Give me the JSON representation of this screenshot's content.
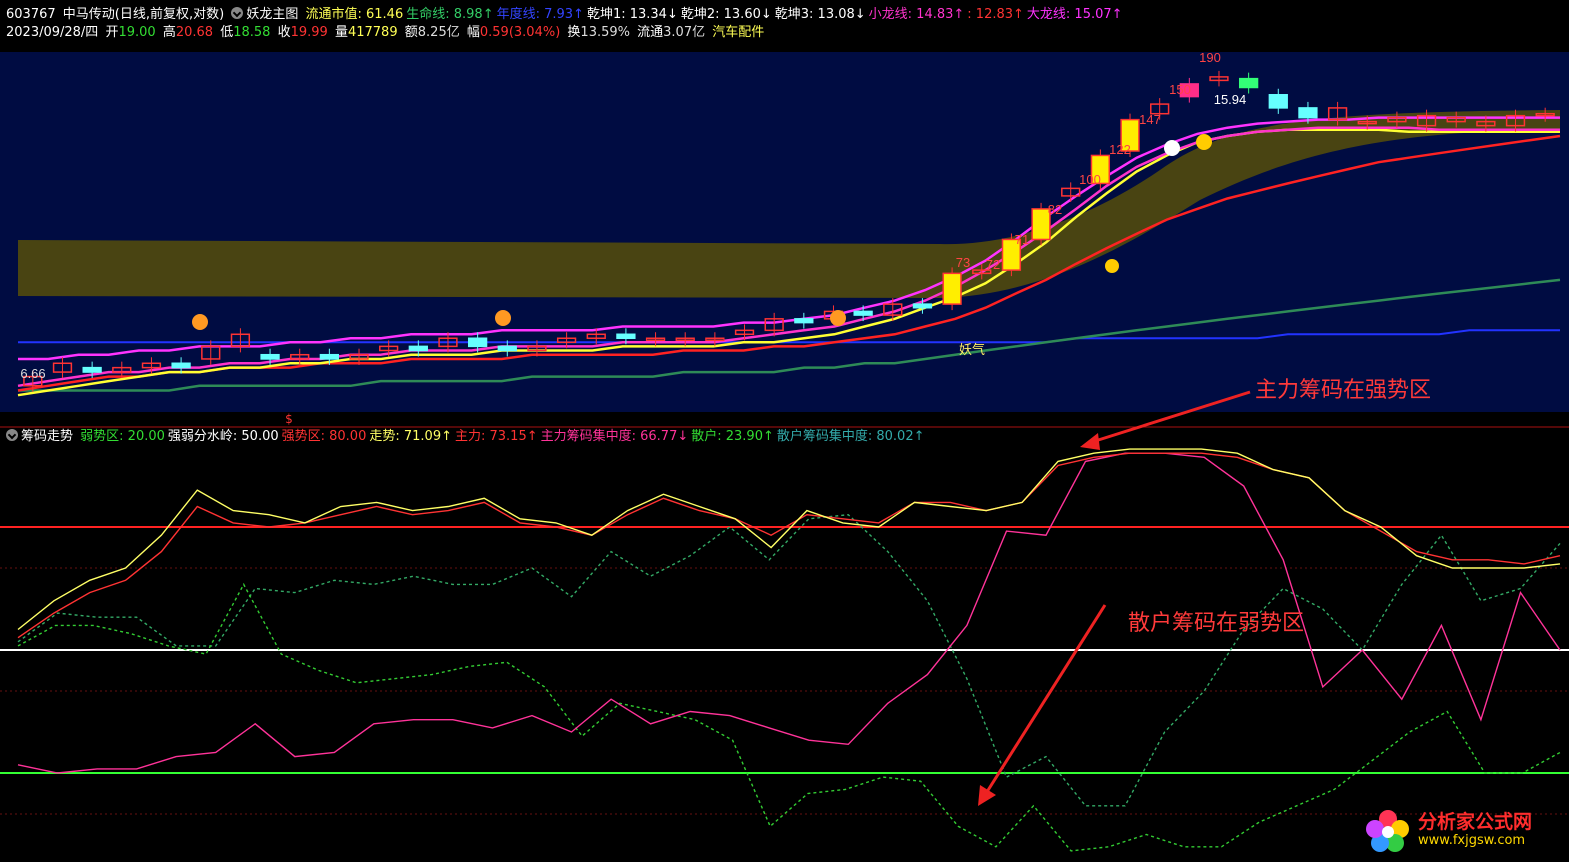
{
  "header": {
    "code": "603767",
    "name_period": "中马传动(日线,前复权,对数)",
    "indicator_name": "妖龙主图",
    "items": [
      {
        "label": "流通市值:",
        "value": "61.46",
        "color": "#ffff55",
        "arrow": ""
      },
      {
        "label": "生命线:",
        "value": "8.98",
        "color": "#33cc66",
        "arrow": "↑"
      },
      {
        "label": "年度线:",
        "value": "7.93",
        "color": "#3344ff",
        "arrow": "↑"
      },
      {
        "label": "乾坤1:",
        "value": "13.34",
        "color": "#ffffff",
        "arrow": "↓"
      },
      {
        "label": "乾坤2:",
        "value": "13.60",
        "color": "#ffffff",
        "arrow": "↓"
      },
      {
        "label": "乾坤3:",
        "value": "13.08",
        "color": "#ffffff",
        "arrow": "↓"
      },
      {
        "label": "小龙线:",
        "value": "14.83",
        "color": "#ff33cc",
        "arrow": "↑"
      },
      {
        "label": ":",
        "value": "12.83",
        "color": "#ff3333",
        "arrow": "↑"
      },
      {
        "label": "大龙线:",
        "value": "15.07",
        "color": "#ff33ff",
        "arrow": "↑"
      }
    ]
  },
  "quote": {
    "date": "2023/09/28/四",
    "open_label": "开",
    "open": "19.00",
    "high_label": "高",
    "high": "20.68",
    "low_label": "低",
    "low": "18.58",
    "close_label": "收",
    "close": "19.99",
    "vol_label": "量",
    "vol": "417789",
    "amt_label": "额",
    "amt": "8.25亿",
    "chg_label": "幅",
    "chg": "0.59(3.04%)",
    "turn_label": "换",
    "turn": "13.59%",
    "float_label": "流通",
    "float": "3.07亿",
    "sector": "汽车配件"
  },
  "indicator": {
    "name": "筹码走势",
    "items": [
      {
        "label": "弱势区:",
        "value": "20.00",
        "color": "#33dd33",
        "arrow": ""
      },
      {
        "label": "强弱分水岭:",
        "value": "50.00",
        "color": "#ffffff",
        "arrow": ""
      },
      {
        "label": "强势区:",
        "value": "80.00",
        "color": "#ff3333",
        "arrow": ""
      },
      {
        "label": "走势:",
        "value": "71.09",
        "color": "#ffff66",
        "arrow": "↑"
      },
      {
        "label": "主力:",
        "value": "73.15",
        "color": "#ff3333",
        "arrow": "↑"
      },
      {
        "label": "主力筹码集中度:",
        "value": "66.77",
        "color": "#ff3399",
        "arrow": "↓"
      },
      {
        "label": "散户:",
        "value": "23.90",
        "color": "#33dd33",
        "arrow": "↑"
      },
      {
        "label": "散户筹码集中度:",
        "value": "80.02",
        "color": "#33aaaa",
        "arrow": "↑"
      }
    ]
  },
  "annotations": {
    "main_strong": "主力筹码在强势区",
    "retail_weak": "散户筹码在弱势区"
  },
  "logo": {
    "cn": "分析家公式网",
    "url": "www.fxjgsw.com"
  },
  "chart_data": [
    {
      "type": "candlestick",
      "title": "妖龙主图",
      "price_labels": [
        "190",
        "150",
        "147",
        "122",
        "100",
        "82",
        "73",
        "72",
        "71",
        "15.94",
        "6.66"
      ],
      "text_marks": [
        "妖气",
        "$"
      ],
      "candles": [
        {
          "o": 6.7,
          "c": 6.9
        },
        {
          "o": 7.0,
          "c": 7.2
        },
        {
          "o": 7.1,
          "c": 7.0
        },
        {
          "o": 7.0,
          "c": 7.1
        },
        {
          "o": 7.1,
          "c": 7.2
        },
        {
          "o": 7.2,
          "c": 7.1
        },
        {
          "o": 7.3,
          "c": 7.6
        },
        {
          "o": 7.6,
          "c": 7.9
        },
        {
          "o": 7.4,
          "c": 7.3
        },
        {
          "o": 7.3,
          "c": 7.4
        },
        {
          "o": 7.4,
          "c": 7.3
        },
        {
          "o": 7.3,
          "c": 7.4
        },
        {
          "o": 7.5,
          "c": 7.6
        },
        {
          "o": 7.6,
          "c": 7.5
        },
        {
          "o": 7.6,
          "c": 7.8
        },
        {
          "o": 7.8,
          "c": 7.6
        },
        {
          "o": 7.6,
          "c": 7.5
        },
        {
          "o": 7.5,
          "c": 7.6
        },
        {
          "o": 7.7,
          "c": 7.8
        },
        {
          "o": 7.8,
          "c": 7.9
        },
        {
          "o": 7.9,
          "c": 7.8
        },
        {
          "o": 7.8,
          "c": 7.8
        },
        {
          "o": 7.8,
          "c": 7.8
        },
        {
          "o": 7.8,
          "c": 7.8
        },
        {
          "o": 7.9,
          "c": 8.0
        },
        {
          "o": 8.0,
          "c": 8.3
        },
        {
          "o": 8.3,
          "c": 8.2
        },
        {
          "o": 8.3,
          "c": 8.5
        },
        {
          "o": 8.5,
          "c": 8.4
        },
        {
          "o": 8.4,
          "c": 8.7
        },
        {
          "o": 8.7,
          "c": 8.6
        },
        {
          "o": 8.7,
          "c": 9.6
        },
        {
          "o": 9.6,
          "c": 9.7
        },
        {
          "o": 9.7,
          "c": 10.7
        },
        {
          "o": 10.7,
          "c": 11.8
        },
        {
          "o": 12.3,
          "c": 12.6
        },
        {
          "o": 12.8,
          "c": 14.0
        },
        {
          "o": 14.2,
          "c": 15.7
        },
        {
          "o": 16.0,
          "c": 16.5
        },
        {
          "o": 16.9,
          "c": 17.6
        },
        {
          "o": 17.8,
          "c": 18.0
        },
        {
          "o": 17.9,
          "c": 17.4
        },
        {
          "o": 17.0,
          "c": 16.3
        },
        {
          "o": 16.3,
          "c": 15.8
        },
        {
          "o": 15.7,
          "c": 16.3
        },
        {
          "o": 15.6,
          "c": 15.6
        },
        {
          "o": 15.6,
          "c": 15.8
        },
        {
          "o": 15.4,
          "c": 15.9
        },
        {
          "o": 15.6,
          "c": 15.8
        },
        {
          "o": 15.4,
          "c": 15.6
        },
        {
          "o": 15.4,
          "c": 15.9
        },
        {
          "o": 15.9,
          "c": 16.0
        }
      ],
      "up_color": "#ff3333",
      "down_color": "#66ffff",
      "limit_up_color": "#ffee00",
      "series": [
        {
          "name": "大龙线",
          "color": "#ff33ff",
          "values": [
            7.3,
            7.3,
            7.4,
            7.4,
            7.5,
            7.5,
            7.6,
            7.6,
            7.6,
            7.7,
            7.7,
            7.8,
            7.8,
            7.9,
            7.9,
            7.9,
            8.0,
            8.0,
            8.0,
            8.0,
            8.1,
            8.1,
            8.1,
            8.1,
            8.2,
            8.2,
            8.3,
            8.4,
            8.6,
            8.8,
            9.1,
            9.5,
            10.0,
            10.7,
            11.5,
            12.3,
            13.1,
            13.9,
            14.5,
            15.0,
            15.3,
            15.5,
            15.6,
            15.7,
            15.7,
            15.8,
            15.8,
            15.8,
            15.8,
            15.8,
            15.8,
            15.8
          ]
        },
        {
          "name": "小龙线",
          "color": "#ff33cc",
          "values": [
            6.7,
            6.8,
            6.9,
            7.0,
            7.0,
            7.1,
            7.1,
            7.2,
            7.2,
            7.3,
            7.3,
            7.4,
            7.4,
            7.5,
            7.5,
            7.5,
            7.6,
            7.6,
            7.6,
            7.6,
            7.7,
            7.7,
            7.7,
            7.7,
            7.8,
            7.9,
            8.0,
            8.1,
            8.3,
            8.5,
            8.8,
            9.2,
            9.7,
            10.3,
            11.0,
            11.8,
            12.7,
            13.5,
            14.1,
            14.6,
            14.9,
            15.1,
            15.2,
            15.3,
            15.3,
            15.3,
            15.3,
            15.2,
            15.2,
            15.2,
            15.2,
            15.2
          ]
        },
        {
          "name": "乾坤",
          "color": "#ffff33",
          "values": [
            6.5,
            6.6,
            6.7,
            6.8,
            6.9,
            7.0,
            7.0,
            7.1,
            7.1,
            7.2,
            7.2,
            7.3,
            7.3,
            7.4,
            7.4,
            7.4,
            7.5,
            7.5,
            7.5,
            7.5,
            7.6,
            7.6,
            7.6,
            7.6,
            7.7,
            7.7,
            7.8,
            7.9,
            8.1,
            8.3,
            8.6,
            8.9,
            9.3,
            9.9,
            10.6,
            11.5,
            12.4,
            13.3,
            14.0,
            14.6,
            14.9,
            15.1,
            15.2,
            15.2,
            15.2,
            15.2,
            15.1,
            15.1,
            15.1,
            15.1,
            15.1,
            15.1
          ]
        },
        {
          "name": "",
          "color": "#ff2222",
          "values": [
            6.6,
            6.7,
            6.8,
            6.9,
            6.9,
            7.0,
            7.0,
            7.1,
            7.1,
            7.1,
            7.2,
            7.2,
            7.2,
            7.3,
            7.3,
            7.3,
            7.3,
            7.4,
            7.4,
            7.4,
            7.4,
            7.4,
            7.5,
            7.5,
            7.5,
            7.6,
            7.6,
            7.7,
            7.8,
            7.9,
            8.1,
            8.3,
            8.6,
            9.0,
            9.4,
            9.9,
            10.4,
            10.9,
            11.4,
            11.8,
            12.2,
            12.5,
            12.8,
            13.1,
            13.4,
            13.7,
            13.9,
            14.1,
            14.3,
            14.5,
            14.7,
            14.9
          ]
        },
        {
          "name": "生命线",
          "color": "#2e8b57",
          "values": [
            6.6,
            6.6,
            6.6,
            6.6,
            6.6,
            6.6,
            6.7,
            6.7,
            6.7,
            6.7,
            6.7,
            6.7,
            6.8,
            6.8,
            6.8,
            6.8,
            6.8,
            6.9,
            6.9,
            6.9,
            6.9,
            6.9,
            7.0,
            7.0,
            7.0,
            7.0,
            7.1,
            7.1,
            7.2,
            7.2,
            7.3,
            7.4,
            7.5,
            7.6,
            7.7,
            7.8,
            7.9,
            8.0,
            8.1,
            8.2,
            8.3,
            8.4,
            8.5,
            8.6,
            8.7,
            8.8,
            8.9,
            9.0,
            9.1,
            9.2,
            9.3,
            9.4
          ]
        },
        {
          "name": "年度线",
          "color": "#2233ff",
          "values": [
            7.7,
            7.7,
            7.7,
            7.7,
            7.7,
            7.7,
            7.7,
            7.7,
            7.7,
            7.7,
            7.7,
            7.7,
            7.7,
            7.7,
            7.7,
            7.7,
            7.7,
            7.7,
            7.7,
            7.7,
            7.7,
            7.7,
            7.7,
            7.7,
            7.7,
            7.7,
            7.7,
            7.7,
            7.7,
            7.7,
            7.7,
            7.7,
            7.7,
            7.7,
            7.7,
            7.8,
            7.8,
            7.8,
            7.8,
            7.8,
            7.8,
            7.8,
            7.9,
            7.9,
            7.9,
            7.9,
            7.9,
            7.9,
            8.0,
            8.0,
            8.0,
            8.0
          ]
        }
      ]
    },
    {
      "type": "line",
      "title": "筹码走势",
      "ylim": [
        0,
        100
      ],
      "hlines": [
        {
          "name": "强势区",
          "value": 80,
          "color": "#ff2222"
        },
        {
          "name": "强弱分水岭",
          "value": 50,
          "color": "#ffffff"
        },
        {
          "name": "弱势区",
          "value": 20,
          "color": "#33ff33"
        }
      ],
      "series": [
        {
          "name": "走势",
          "color": "#ffff66",
          "dash": false,
          "values": [
            55,
            62,
            67,
            70,
            78,
            89,
            84,
            83,
            81,
            85,
            86,
            84,
            85,
            87,
            82,
            81,
            78,
            84,
            88,
            85,
            82,
            75,
            84,
            81,
            80,
            86,
            85,
            84,
            86,
            96,
            98,
            99,
            99,
            99,
            98,
            94,
            92,
            84,
            80,
            73,
            70,
            70,
            70,
            71
          ]
        },
        {
          "name": "主力",
          "color": "#ff3333",
          "dash": false,
          "values": [
            53,
            59,
            64,
            67,
            74,
            85,
            81,
            80,
            81,
            83,
            85,
            83,
            84,
            86,
            81,
            80,
            78,
            83,
            87,
            84,
            82,
            78,
            83,
            82,
            81,
            86,
            86,
            84,
            86,
            95,
            97,
            98,
            98,
            98,
            97,
            94,
            92,
            84,
            79,
            74,
            72,
            72,
            71,
            73
          ]
        },
        {
          "name": "主力筹码集中度",
          "color": "#ff3399",
          "dash": false,
          "values": [
            22,
            20,
            21,
            21,
            24,
            25,
            32,
            24,
            25,
            32,
            33,
            33,
            31,
            34,
            30,
            38,
            32,
            35,
            34,
            31,
            28,
            27,
            37,
            44,
            56,
            79,
            78,
            96,
            98,
            98,
            97,
            90,
            72,
            41,
            50,
            38,
            56,
            33,
            64,
            50
          ]
        },
        {
          "name": "散户",
          "color": "#33cc33",
          "dash": true,
          "values": [
            51,
            56,
            56,
            54,
            51,
            49,
            66,
            49,
            45,
            42,
            43,
            44,
            46,
            47,
            41,
            29,
            37,
            35,
            33,
            28,
            7,
            15,
            16,
            19,
            18,
            7,
            2,
            12,
            1,
            2,
            5,
            2,
            2,
            8,
            12,
            16,
            23,
            30,
            35,
            20,
            20,
            25
          ]
        },
        {
          "name": "散户筹码集中度",
          "color": "#33aa66",
          "dash": true,
          "values": [
            52,
            59,
            58,
            58,
            51,
            51,
            65,
            64,
            67,
            66,
            68,
            66,
            66,
            70,
            63,
            74,
            68,
            73,
            80,
            72,
            82,
            83,
            74,
            62,
            43,
            19,
            24,
            12,
            12,
            30,
            40,
            55,
            65,
            60,
            50,
            66,
            78,
            62,
            65,
            76
          ]
        }
      ]
    }
  ]
}
